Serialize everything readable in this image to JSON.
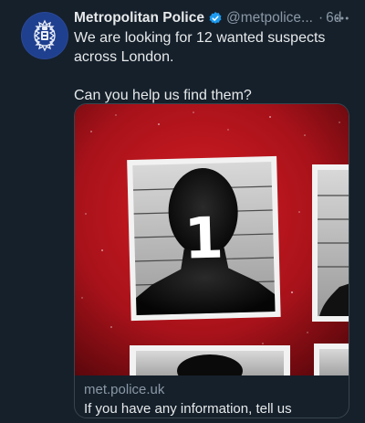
{
  "author": {
    "name": "Metropolitan Police",
    "handle": "@metpolice...",
    "separator": "·",
    "time": "6d",
    "avatar_icon": "met-police-crest-icon",
    "verified_icon": "verified-badge-icon"
  },
  "tweet": {
    "line1": "We are looking for 12 wanted suspects",
    "line2": "across London.",
    "line3": "Can you help us find them?"
  },
  "card": {
    "poster_number": "1",
    "domain": "met.police.uk",
    "title": "If you have any information, tell us"
  },
  "icons": {
    "more": "more-options-icon"
  },
  "colors": {
    "background": "#15202b",
    "poster_red": "#b3131c",
    "verified_blue": "#1d9bf0",
    "crest_blue": "#1f3f8f"
  }
}
